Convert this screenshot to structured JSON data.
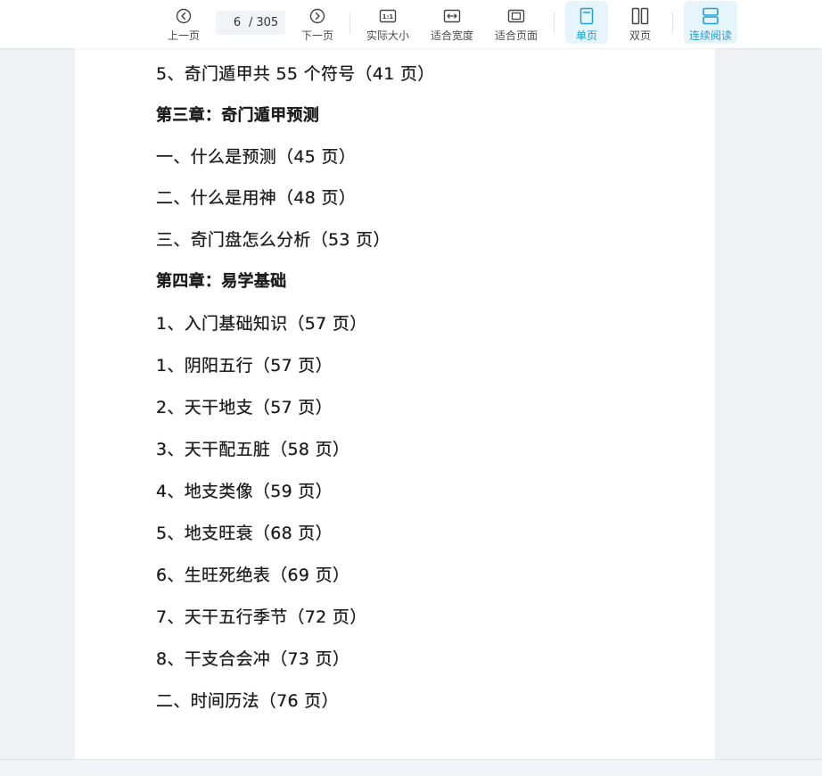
{
  "toolbar": {
    "prev_label": "上一页",
    "next_label": "下一页",
    "current_page": "6",
    "page_sep": "/",
    "total_pages": "305",
    "actual_size_label": "实际大小",
    "fit_width_label": "适合宽度",
    "fit_page_label": "适合页面",
    "single_page_label": "单页",
    "double_page_label": "双页",
    "continuous_label": "连续阅读",
    "accent_color": "#1e9fd6"
  },
  "document": {
    "lines": [
      {
        "text": "5、奇门遁甲共 55 个符号（41 页）",
        "chapter": false
      },
      {
        "text": "第三章：奇门遁甲预测",
        "chapter": true
      },
      {
        "text": "一、什么是预测（45 页）",
        "chapter": false
      },
      {
        "text": "二、什么是用神（48 页）",
        "chapter": false
      },
      {
        "text": "三、奇门盘怎么分析（53 页）",
        "chapter": false
      },
      {
        "text": "第四章：易学基础",
        "chapter": true
      },
      {
        "text": "1、入门基础知识（57 页）",
        "chapter": false
      },
      {
        "text": "1、阴阳五行（57 页）",
        "chapter": false
      },
      {
        "text": "2、天干地支（57 页）",
        "chapter": false
      },
      {
        "text": "3、天干配五脏（58 页）",
        "chapter": false
      },
      {
        "text": "4、地支类像（59 页）",
        "chapter": false
      },
      {
        "text": "5、地支旺衰（68 页）",
        "chapter": false
      },
      {
        "text": "6、生旺死绝表（69 页）",
        "chapter": false
      },
      {
        "text": "7、天干五行季节（72 页）",
        "chapter": false
      },
      {
        "text": "8、干支合会冲（73 页）",
        "chapter": false
      },
      {
        "text": "二、时间历法（76 页）",
        "chapter": false
      }
    ]
  }
}
